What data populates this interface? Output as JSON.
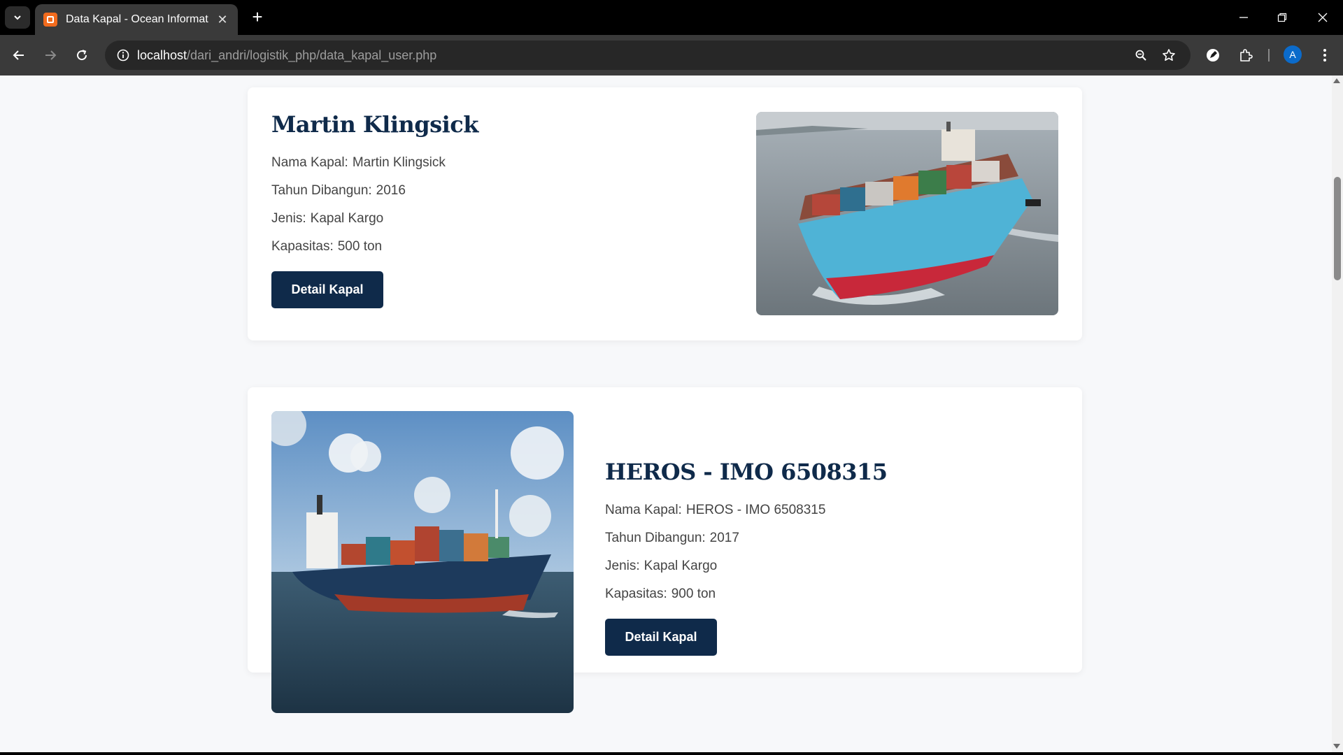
{
  "browser": {
    "tab_title": "Data Kapal - Ocean Information",
    "url_host": "localhost",
    "url_path": "/dari_andri/logistik_php/data_kapal_user.php",
    "avatar_letter": "A"
  },
  "ships": [
    {
      "name": "Martin Klingsick",
      "nama_label": "Nama Kapal:",
      "nama_value": "Martin Klingsick",
      "tahun_label": "Tahun Dibangun:",
      "tahun_value": "2016",
      "jenis_label": "Jenis:",
      "jenis_value": "Kapal Kargo",
      "kapasitas_label": "Kapasitas:",
      "kapasitas_value": "500 ton",
      "button_label": "Detail Kapal"
    },
    {
      "name": "HEROS - IMO 6508315",
      "nama_label": "Nama Kapal:",
      "nama_value": "HEROS - IMO 6508315",
      "tahun_label": "Tahun Dibangun:",
      "tahun_value": "2017",
      "jenis_label": "Jenis:",
      "jenis_value": "Kapal Kargo",
      "kapasitas_label": "Kapasitas:",
      "kapasitas_value": "900 ton",
      "button_label": "Detail Kapal"
    }
  ],
  "colors": {
    "navy": "#0f2a4a",
    "background": "#f7f8fa"
  }
}
